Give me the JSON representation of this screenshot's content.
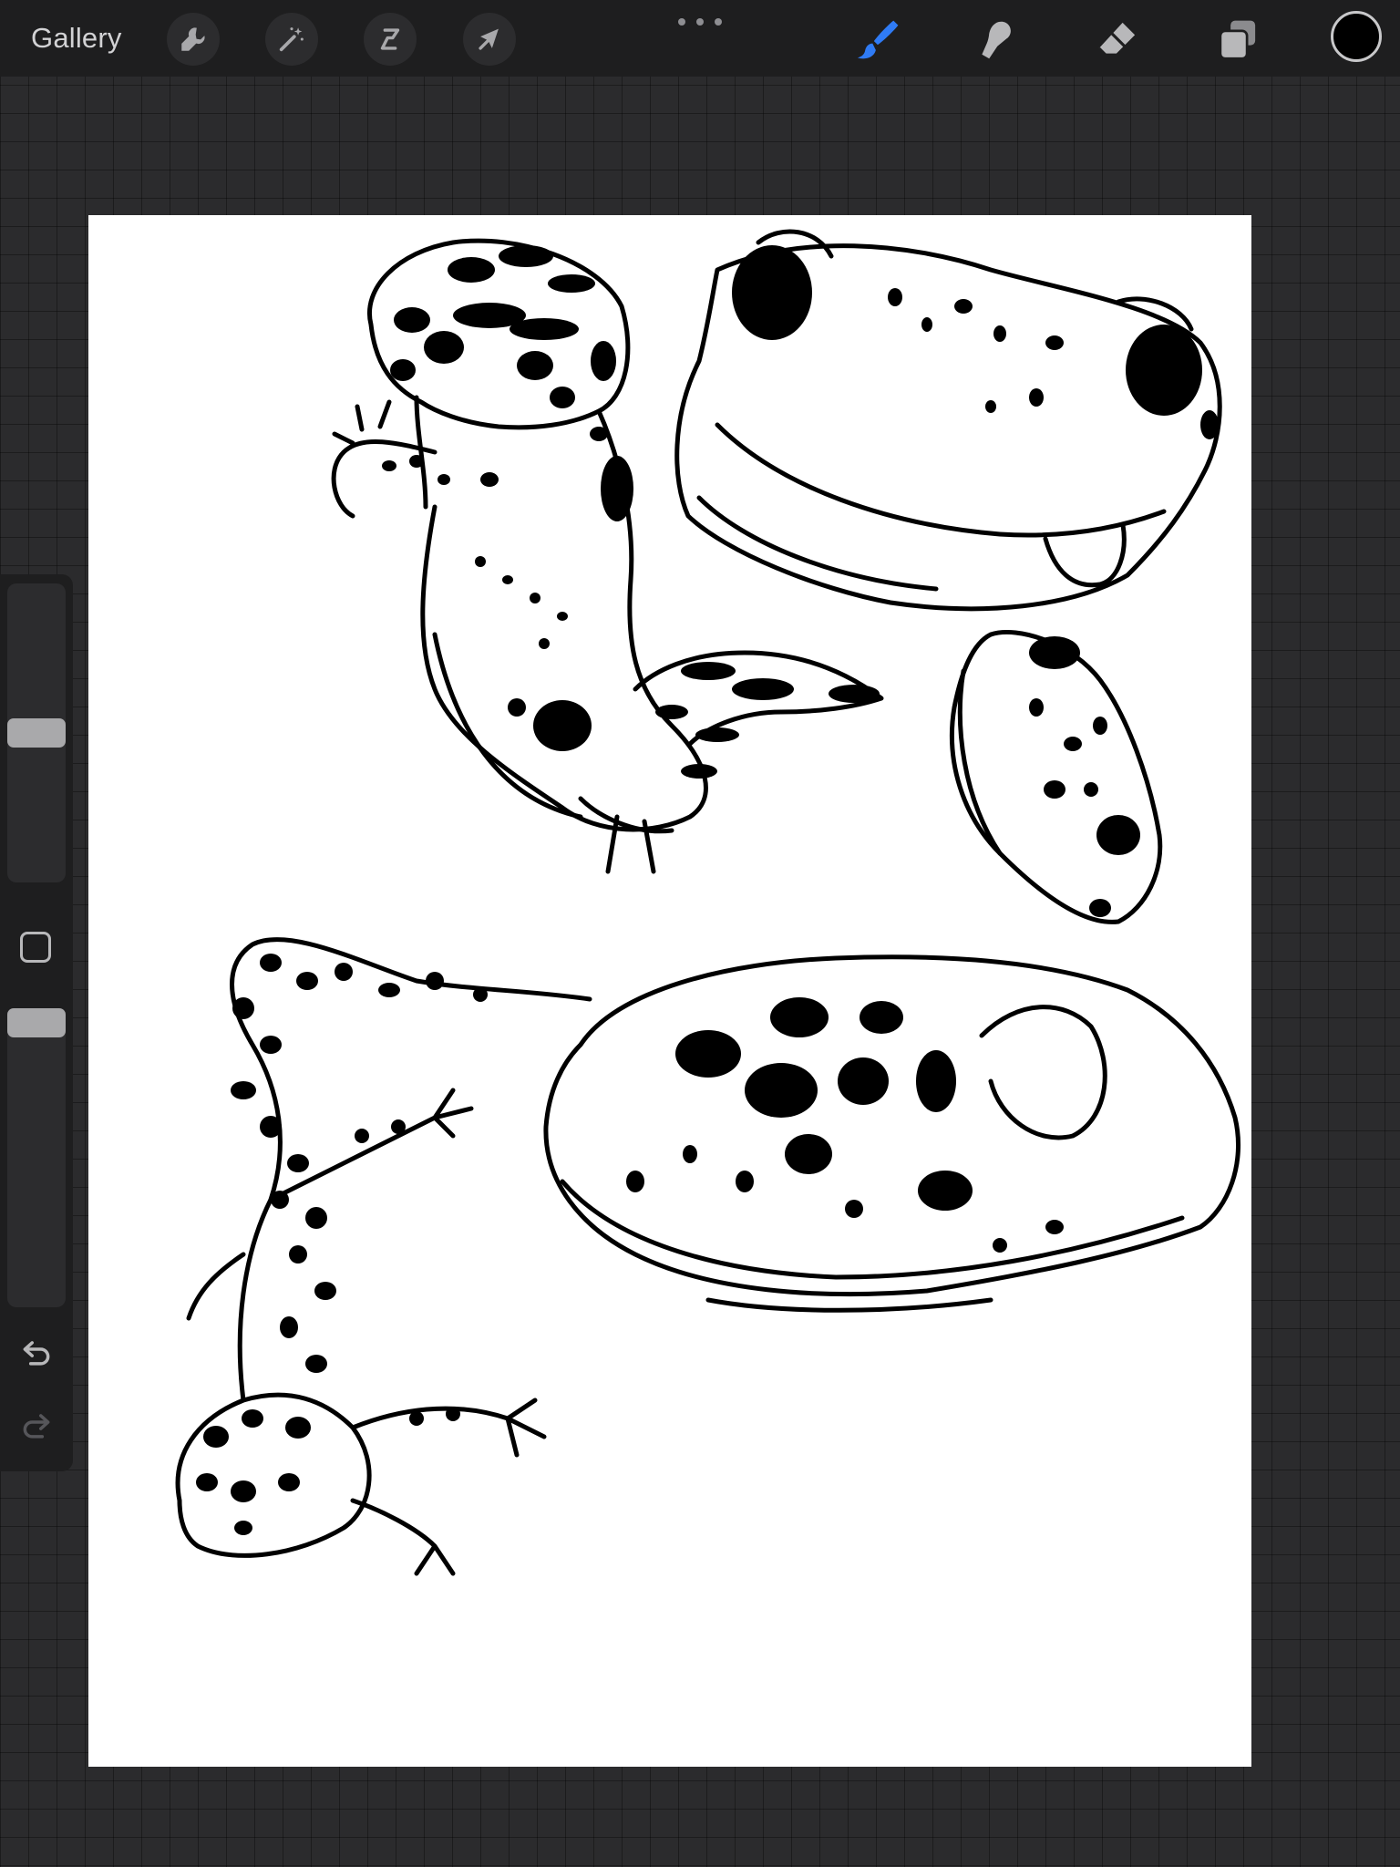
{
  "toolbar": {
    "gallery_label": "Gallery",
    "left_tools": [
      {
        "icon": "wrench-icon"
      },
      {
        "icon": "magic-wand-icon"
      },
      {
        "icon": "selection-icon"
      },
      {
        "icon": "transform-arrow-icon"
      }
    ],
    "right_tools": [
      {
        "icon": "brush-icon",
        "active": true
      },
      {
        "icon": "smudge-icon",
        "active": false
      },
      {
        "icon": "eraser-icon",
        "active": false
      },
      {
        "icon": "layers-icon",
        "active": false
      }
    ],
    "current_color": "#000000",
    "active_color": "#2f7bf5"
  },
  "sidebar": {
    "brush_size_level": 0.5,
    "opacity_level": 0.0
  },
  "canvas": {
    "background": "#ffffff",
    "ink": "#000000"
  }
}
